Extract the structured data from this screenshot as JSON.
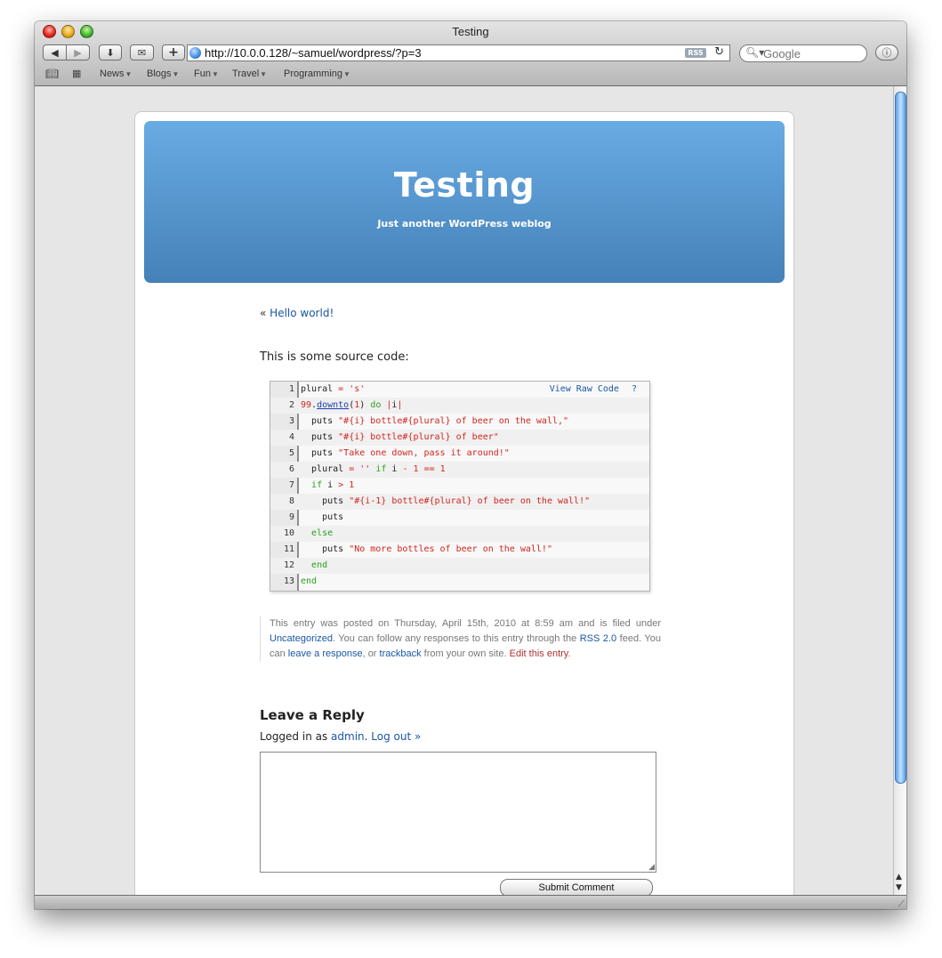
{
  "window": {
    "title": "Testing"
  },
  "toolbar": {
    "url": "http://10.0.0.128/~samuel/wordpress/?p=3",
    "rss_label": "RSS",
    "search_placeholder": "Google"
  },
  "bookmarks": [
    "News",
    "Blogs",
    "Fun",
    "Travel",
    "Programming"
  ],
  "blog": {
    "title": "Testing",
    "description": "Just another WordPress weblog"
  },
  "nav": {
    "prev_marker": "«",
    "prev_label": "Hello world!"
  },
  "post": {
    "intro": "This is some source code:"
  },
  "code": {
    "view_raw": "View Raw Code",
    "help": "?",
    "line_numbers": [
      "1",
      "2",
      "3",
      "4",
      "5",
      "6",
      "7",
      "8",
      "9",
      "10",
      "11",
      "12",
      "13"
    ]
  },
  "meta": {
    "t1": "This entry was posted on Thursday, April 15th, 2010 at 8:59 am and is filed under ",
    "category": "Uncategorized",
    "t2": ". You can follow any responses to this entry through the ",
    "rss": "RSS 2.0",
    "t3": " feed. You can ",
    "leave_response": "leave a response",
    "t4": ", or ",
    "trackback": "trackback",
    "t5": " from your own site. ",
    "edit": "Edit this entry",
    "t6": "."
  },
  "reply": {
    "heading": "Leave a Reply",
    "logged_in_prefix": "Logged in as ",
    "user": "admin",
    "sep": ". ",
    "logout": "Log out »",
    "submit": "Submit Comment"
  }
}
